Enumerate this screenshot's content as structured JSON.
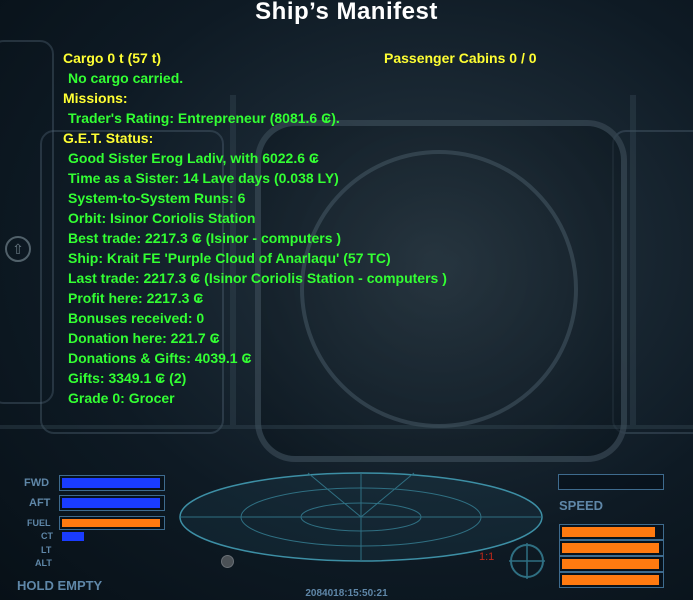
{
  "screen_title": "Ship’s Manifest",
  "cargo": {
    "header": "Cargo 0 t (57 t)",
    "status": "No cargo carried."
  },
  "cabins": {
    "header": "Passenger Cabins 0 / 0"
  },
  "missions": {
    "header": "Missions:",
    "trader_rating": "Trader's Rating: Entrepreneur (8081.6 ₢)."
  },
  "get_status": {
    "header": "G.E.T. Status:",
    "lines": [
      "Good Sister Erog Ladiv, with 6022.6 ₢",
      "Time as a Sister: 14 Lave days (0.038 LY)",
      "System-to-System Runs: 6",
      "Orbit: Isinor Coriolis Station",
      "Best trade: 2217.3 ₢ (Isinor - computers )",
      "Ship: Krait FE 'Purple Cloud of Anarlaqu' (57 TC)",
      "Last trade: 2217.3 ₢ (Isinor Coriolis Station - computers )",
      "Profit here: 2217.3 ₢",
      "Bonuses received: 0",
      "Donation here: 221.7 ₢",
      "Donations & Gifts: 4039.1 ₢",
      "Gifts: 3349.1 ₢ (2)",
      "Grade 0: Grocer"
    ]
  },
  "hud": {
    "labels": {
      "fwd": "FWD",
      "aft": "AFT",
      "fuel": "FUEL",
      "ct": "CT",
      "lt": "LT",
      "alt": "ALT",
      "speed": "SPEED",
      "hold": "HOLD  EMPTY",
      "ratio": "1:1"
    },
    "levels": {
      "fwd_shield": 1.0,
      "aft_shield": 1.0,
      "fuel": 1.0,
      "cabin_temp": 0.22,
      "laser_temp": 0.0,
      "altitude": 0.0,
      "speed": 0.0,
      "energy_banks": [
        0.96,
        1.0,
        1.0,
        1.0
      ]
    },
    "clock": "2084018:15:50:21"
  },
  "colors": {
    "title": "#ffffff",
    "header": "#ffff33",
    "text": "#33ff33",
    "hud": "#5f87a8",
    "shield": "#1a3cff",
    "energy": "#ff7a10"
  }
}
